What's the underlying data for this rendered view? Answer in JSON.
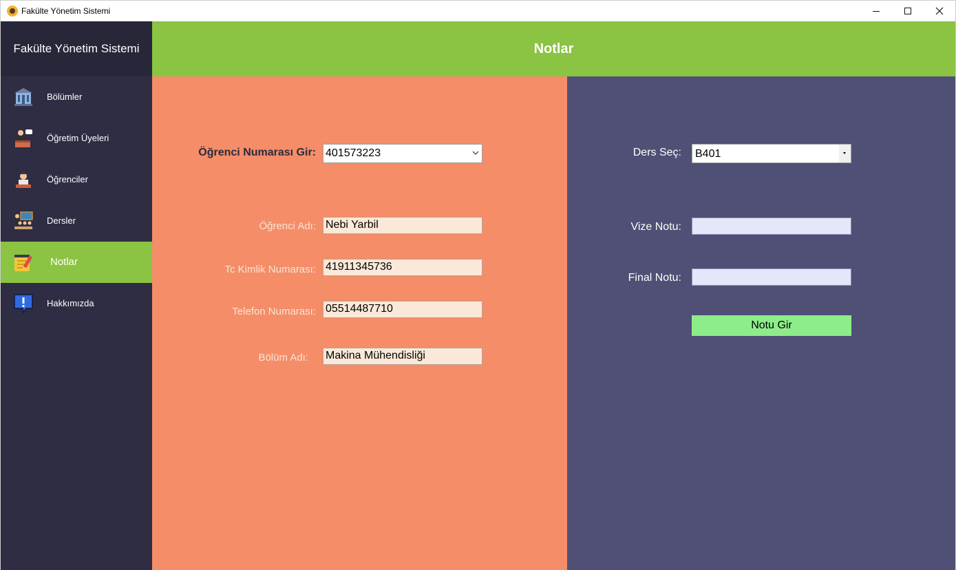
{
  "window": {
    "title": "Fakülte Yönetim Sistemi"
  },
  "sidebar": {
    "title": "Fakülte Yönetim Sistemi",
    "items": [
      {
        "label": "Bölümler",
        "icon": "building-icon",
        "active": false
      },
      {
        "label": "Öğretim Üyeleri",
        "icon": "lecturer-icon",
        "active": false
      },
      {
        "label": "Öğrenciler",
        "icon": "student-icon",
        "active": false
      },
      {
        "label": "Dersler",
        "icon": "classroom-icon",
        "active": false
      },
      {
        "label": "Notlar",
        "icon": "notepad-icon",
        "active": true
      },
      {
        "label": "Hakkımızda",
        "icon": "info-message-icon",
        "active": false
      }
    ]
  },
  "header": {
    "title": "Notlar"
  },
  "student": {
    "number_label": "Öğrenci Numarası Gir:",
    "number_value": "401573223",
    "name_label": "Öğrenci Adı:",
    "name_value": "Nebi  Yarbil",
    "tc_label": "Tc Kimlik Numarası:",
    "tc_value": "41911345736",
    "phone_label": "Telefon Numarası:",
    "phone_value": "05514487710",
    "department_label": "Bölüm Adı:",
    "department_value": "Makina Mühendisliği"
  },
  "grades": {
    "course_label": "Ders Seç:",
    "course_value": "B401",
    "midterm_label": "Vize Notu:",
    "midterm_value": "",
    "final_label": "Final Notu:",
    "final_value": "",
    "submit_label": "Notu Gir"
  },
  "colors": {
    "sidebar_bg": "#2e2d44",
    "accent_green": "#8bc342",
    "left_panel": "#f48d68",
    "right_panel": "#505076",
    "button_green": "#8ded8a"
  }
}
